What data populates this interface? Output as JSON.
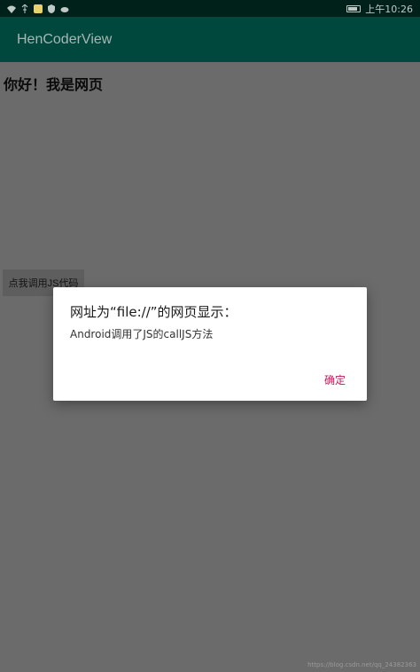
{
  "status_bar": {
    "time": "上午10:26",
    "icons": [
      "wifi-icon",
      "usb-icon",
      "notification-icon",
      "shield-icon",
      "cloud-icon",
      "battery-icon"
    ]
  },
  "app_bar": {
    "title": "HenCoderView"
  },
  "webview": {
    "heading": "你好！我是网页",
    "button_label": "点我调用JS代码"
  },
  "dialog": {
    "title": "网址为“file://”的网页显示：",
    "message": "Android调用了JS的callJS方法",
    "ok_label": "确定",
    "accent_color": "#c2185b"
  },
  "watermark": "https://blog.csdn.net/qq_24382363",
  "colors": {
    "app_bar": "#00483d",
    "status_bar": "#00201a",
    "scrim": "#6b6b6b"
  }
}
